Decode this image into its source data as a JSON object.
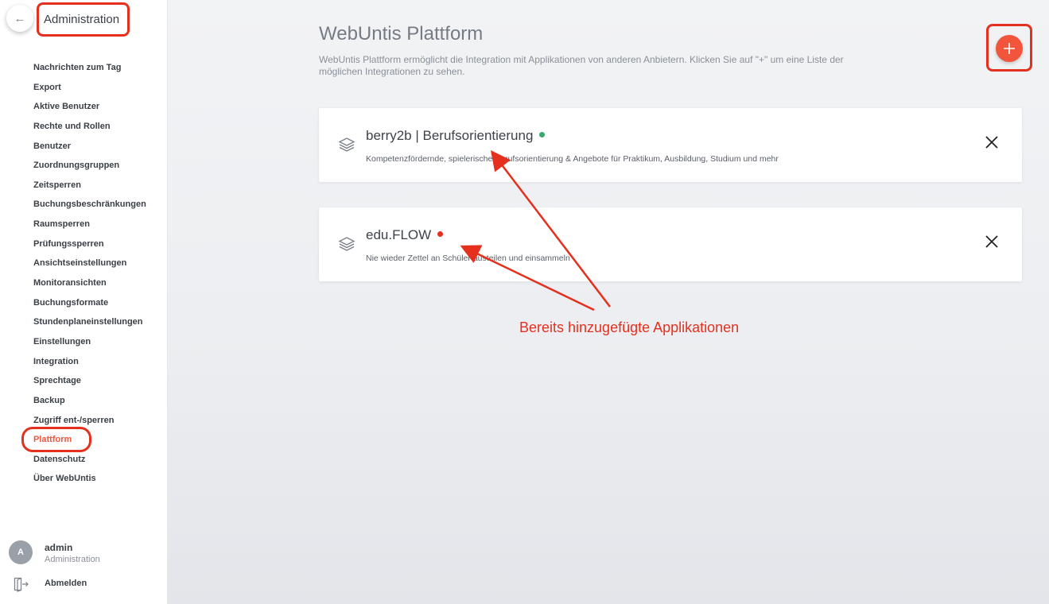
{
  "sidebar": {
    "back_icon": "arrow-left-icon",
    "title": "Administration",
    "items": [
      {
        "label": "Nachrichten zum Tag"
      },
      {
        "label": "Export"
      },
      {
        "label": "Aktive Benutzer"
      },
      {
        "label": "Rechte und Rollen"
      },
      {
        "label": "Benutzer"
      },
      {
        "label": "Zuordnungsgruppen"
      },
      {
        "label": "Zeitsperren"
      },
      {
        "label": "Buchungsbeschränkungen"
      },
      {
        "label": "Raumsperren"
      },
      {
        "label": "Prüfungssperren"
      },
      {
        "label": "Ansichtseinstellungen"
      },
      {
        "label": "Monitoransichten"
      },
      {
        "label": "Buchungsformate"
      },
      {
        "label": "Stundenplaneinstellungen"
      },
      {
        "label": "Einstellungen"
      },
      {
        "label": "Integration"
      },
      {
        "label": "Sprechtage"
      },
      {
        "label": "Backup"
      },
      {
        "label": "Zugriff ent-/sperren"
      },
      {
        "label": "Plattform",
        "active": true
      },
      {
        "label": "Datenschutz"
      },
      {
        "label": "Über WebUntis"
      }
    ],
    "user": {
      "initial": "A",
      "name": "admin",
      "role": "Administration"
    },
    "logout": {
      "label": "Abmelden",
      "icon": "logout-icon"
    }
  },
  "main": {
    "title": "WebUntis Plattform",
    "description": "WebUntis Plattform ermöglicht die Integration mit Applikationen von anderen Anbietern. Klicken Sie auf \"+\" um eine Liste der möglichen Integrationen zu sehen.",
    "add_icon": "plus-icon",
    "apps": [
      {
        "name": "berry2b | Berufsorientierung",
        "status": "active",
        "status_color": "#3aa76d",
        "description": "Kompetenzfördernde, spielerische Berufsorientierung & Angebote für Praktikum, Ausbildung, Studium und mehr"
      },
      {
        "name": "edu.FLOW",
        "status": "inactive",
        "status_color": "#e5301e",
        "description": "Nie wieder Zettel an Schüler austeilen und einsammeln"
      }
    ]
  },
  "annotation": {
    "text": "Bereits hinzugefügte Applikationen",
    "color": "#e5301e"
  },
  "colors": {
    "accent": "#f2553c"
  }
}
